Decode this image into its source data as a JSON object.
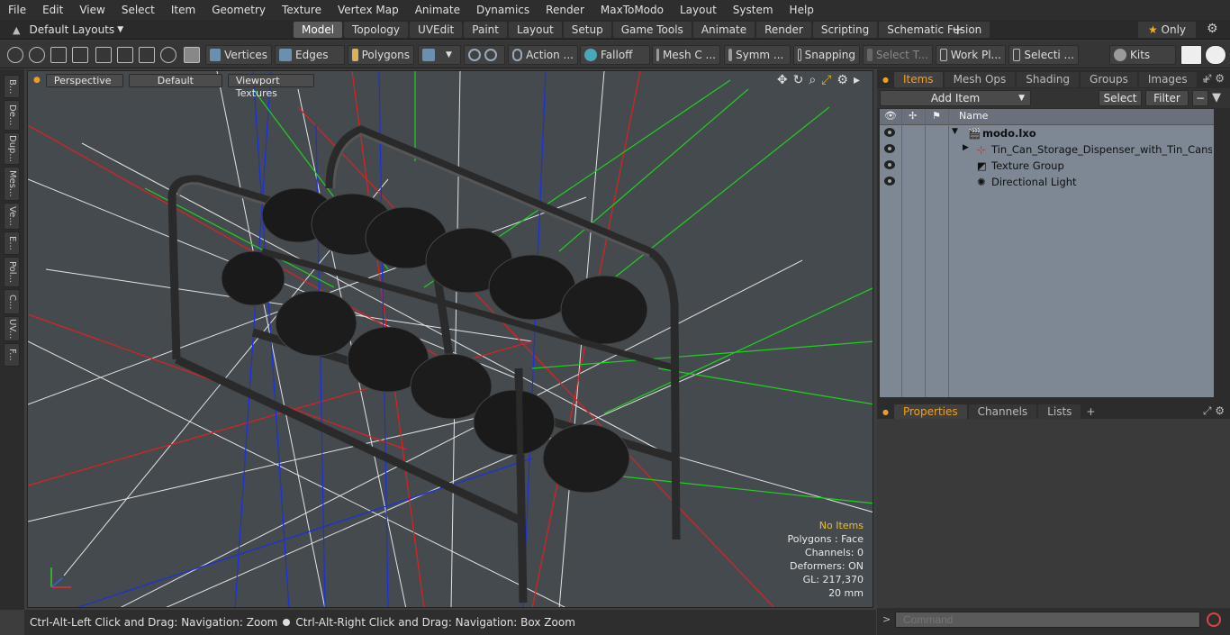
{
  "menu": [
    "File",
    "Edit",
    "View",
    "Select",
    "Item",
    "Geometry",
    "Texture",
    "Vertex Map",
    "Animate",
    "Dynamics",
    "Render",
    "MaxToModo",
    "Layout",
    "System",
    "Help"
  ],
  "layouts_label": "Default Layouts",
  "mode_tabs": [
    "Model",
    "Topology",
    "UVEdit",
    "Paint",
    "Layout",
    "Setup",
    "Game Tools",
    "Animate",
    "Render",
    "Scripting",
    "Schematic Fusion"
  ],
  "only_label": "Only",
  "toolbar": {
    "vertices": "Vertices",
    "edges": "Edges",
    "polygons": "Polygons",
    "action": "Action ...",
    "falloff": "Falloff",
    "mesh": "Mesh C ...",
    "symmetry": "Symm ...",
    "snapping": "Snapping",
    "select_t": "Select T...",
    "workplane": "Work Pl...",
    "selection": "Selecti ...",
    "kits": "Kits"
  },
  "left_tabs": [
    "B...",
    "De...",
    "Dup...",
    "Mes...",
    "Ve...",
    "E...",
    "Pol...",
    "C...",
    "UV...",
    "F..."
  ],
  "viewport": {
    "perspective": "Perspective",
    "default": "Default",
    "textures": "Viewport Textures",
    "info": {
      "no_items": "No Items",
      "polygons": "Polygons : Face",
      "channels": "Channels: 0",
      "deformers": "Deformers: ON",
      "gl": "GL: 217,370",
      "scale": "20 mm"
    }
  },
  "status_left": "Ctrl-Alt-Left Click and Drag: Navigation: Zoom",
  "status_right": "Ctrl-Alt-Right Click and Drag: Navigation: Box Zoom",
  "panel_tabs": [
    "Items",
    "Mesh Ops",
    "Shading",
    "Groups",
    "Images"
  ],
  "add_item": "Add Item",
  "select_btn": "Select",
  "filter_btn": "Filter",
  "tree_header": "Name",
  "tree": [
    {
      "label": "modo.lxo"
    },
    {
      "label": "Tin_Can_Storage_Dispenser_with_Tin_Cans_a ..."
    },
    {
      "label": "Texture Group"
    },
    {
      "label": "Directional Light"
    }
  ],
  "prop_tabs": [
    "Properties",
    "Channels",
    "Lists"
  ],
  "command_placeholder": "Command"
}
